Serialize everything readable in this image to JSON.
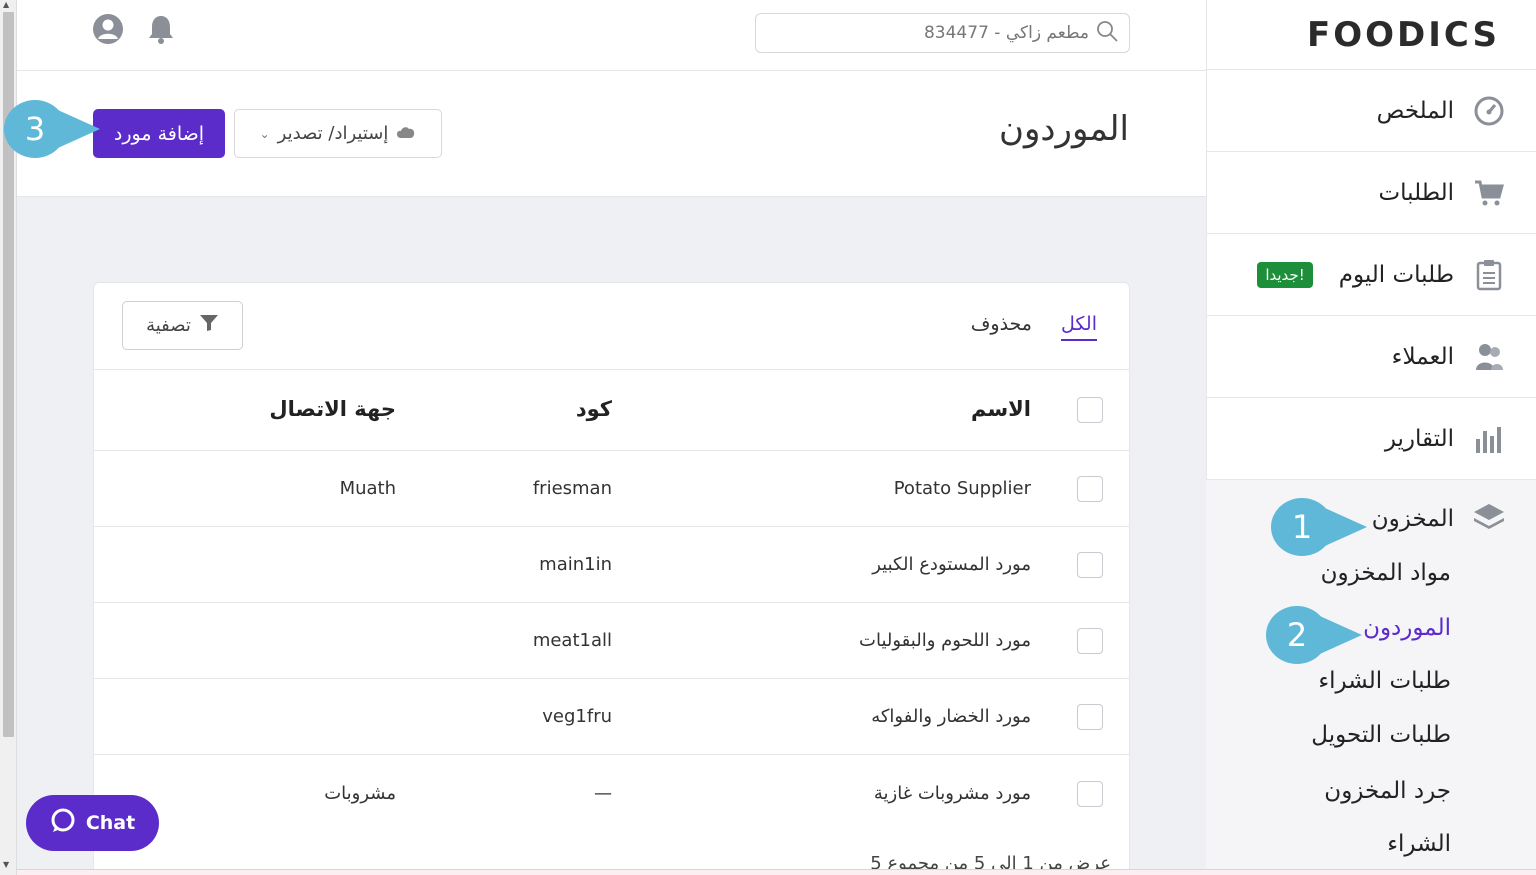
{
  "brand": {
    "logo_text": "FOODICS"
  },
  "topbar": {
    "search_text": "مطعم زاكي - 834477",
    "icons": [
      "user-icon",
      "bell-icon",
      "search-icon"
    ]
  },
  "sidebar": {
    "items": [
      {
        "label": "الملخص",
        "icon": "dashboard-icon"
      },
      {
        "label": "الطلبات",
        "icon": "cart-icon"
      },
      {
        "label": "طلبات اليوم",
        "icon": "clipboard-icon",
        "badge": "جديدا!"
      },
      {
        "label": "العملاء",
        "icon": "customers-icon"
      },
      {
        "label": "التقارير",
        "icon": "bar-chart-icon"
      }
    ],
    "inventory": {
      "label": "المخزون",
      "icon": "layers-icon",
      "sub_items": [
        "مواد المخزون",
        "الموردون",
        "طلبات الشراء",
        "طلبات التحويل",
        "جرد المخزون",
        "الشراء"
      ],
      "active_sub_item": "الموردون"
    }
  },
  "header": {
    "title": "الموردون",
    "add_button": "إضافة مورد",
    "import_export_button": "إستيراد/ تصدير"
  },
  "tabs": {
    "all": "الكل",
    "deleted": "محذوف",
    "active": "الكل"
  },
  "filter_button": "تصفية",
  "table": {
    "columns": {
      "name": "الاسم",
      "code": "كود",
      "contact": "جهة الاتصال"
    },
    "rows": [
      {
        "name": "Potato Supplier",
        "code": "friesman",
        "contact": "Muath"
      },
      {
        "name": "مورد المستودع الكبير",
        "code": "main1in",
        "contact": ""
      },
      {
        "name": "مورد اللحوم والبقوليات",
        "code": "meat1all",
        "contact": ""
      },
      {
        "name": "مورد الخضار والفواكه",
        "code": "veg1fru",
        "contact": ""
      },
      {
        "name": "مورد مشروبات غازية",
        "code": "—",
        "contact": "مشروبات"
      }
    ],
    "footer": "عرض من 1 الى 5 من مجموع 5"
  },
  "callouts": [
    "1",
    "2",
    "3"
  ],
  "chat": {
    "label": "Chat"
  },
  "colors": {
    "accent": "#5b2cc9",
    "badge": "#1d8f3a",
    "callout": "#5fb8d8"
  }
}
